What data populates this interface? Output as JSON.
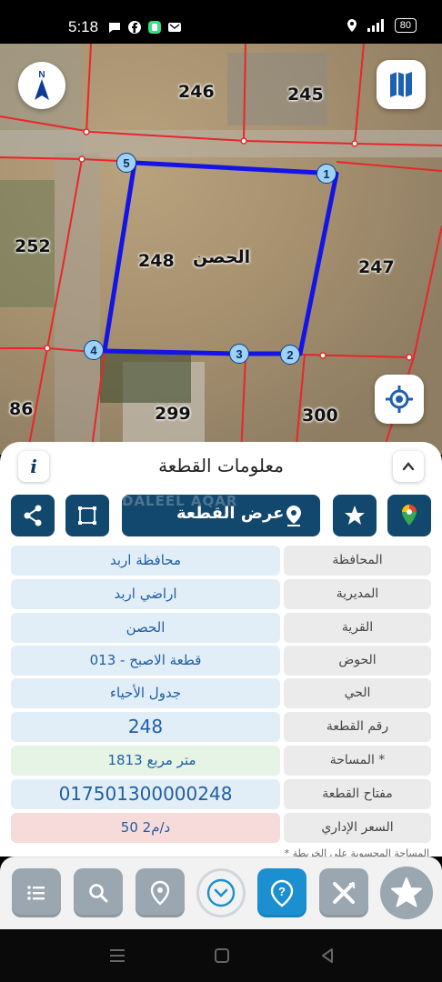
{
  "status_bar": {
    "time": "5:18",
    "battery": "80"
  },
  "map": {
    "parcels": {
      "p246": "246",
      "p245": "245",
      "p252": "252",
      "p248": "248",
      "p247": "247",
      "p86": "86",
      "p299": "299",
      "p300": "300",
      "p248_village": "الحصن"
    },
    "vertices": [
      "1",
      "2",
      "3",
      "4",
      "5"
    ],
    "colors": {
      "boundary": "#1414e6",
      "cadastral": "#e8262b"
    }
  },
  "sheet": {
    "title": "معلومات القطعة",
    "info_label": "i",
    "view_parcel_label": "عرض القطعة",
    "watermark": "DALEEL AQAR",
    "rows": [
      {
        "label": "المحافظة",
        "value": "محافظة اربد"
      },
      {
        "label": "المديرية",
        "value": "اراضي اربد"
      },
      {
        "label": "القرية",
        "value": "الحصن"
      },
      {
        "label": "الحوض",
        "value": "قطعة الاصبح - 013"
      },
      {
        "label": "الحي",
        "value": "جدول الأحياء"
      },
      {
        "label": "رقم القطعة",
        "value": "248"
      },
      {
        "label": "المساحة *",
        "value": "1813",
        "unit": "متر مربع"
      },
      {
        "label": "مفتاح القطعة",
        "value": "017501300000248"
      },
      {
        "label": "السعر الإداري",
        "value": "50 د/م2"
      }
    ],
    "footnote": "* المساحة المحسوبة على الخريطة"
  },
  "colors": {
    "primary": "#12476e",
    "accent": "#1b8fd0"
  }
}
